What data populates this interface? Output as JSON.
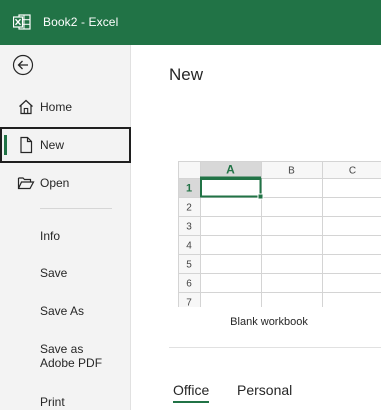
{
  "titlebar": {
    "title": "Book2  -  Excel",
    "app_icon": "excel-logo-icon"
  },
  "sidebar": {
    "back_icon": "back-arrow-icon",
    "main_items": [
      {
        "label": "Home",
        "icon": "home-icon"
      },
      {
        "label": "New",
        "icon": "new-document-icon",
        "selected": true
      },
      {
        "label": "Open",
        "icon": "open-folder-icon"
      }
    ],
    "secondary_items": [
      "Info",
      "Save",
      "Save As",
      "Save as Adobe PDF",
      "Print"
    ]
  },
  "main": {
    "title": "New",
    "template": {
      "caption": "Blank workbook",
      "columns": [
        "A",
        "B",
        "C"
      ],
      "rows": [
        "1",
        "2",
        "3",
        "4",
        "5",
        "6",
        "7"
      ]
    },
    "tabs": [
      {
        "label": "Office",
        "active": true
      },
      {
        "label": "Personal",
        "active": false
      }
    ]
  },
  "colors": {
    "brand": "#217346",
    "sidebar_bg": "#f3f3f3"
  }
}
